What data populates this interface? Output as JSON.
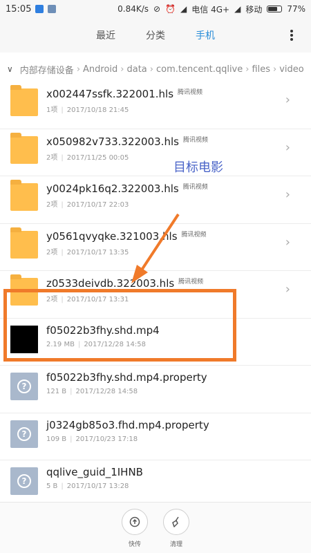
{
  "status_bar": {
    "time": "15:05",
    "speed": "0.84K/s",
    "carrier1": "电信 4G+",
    "carrier2": "移动",
    "battery_text": "77%",
    "battery_level": 0.77
  },
  "header": {
    "tabs": [
      {
        "label": "最近",
        "active": false
      },
      {
        "label": "分类",
        "active": false
      },
      {
        "label": "手机",
        "active": true
      }
    ]
  },
  "breadcrumb": {
    "parts": [
      "内部存储设备",
      "Android",
      "data",
      "com.tencent.qqlive",
      "files",
      "video"
    ]
  },
  "files": [
    {
      "name": "x002447ssfk.322001.hls",
      "tag": "腾讯视频",
      "size": "1项",
      "date": "2017/10/18 21:45",
      "type": "folder"
    },
    {
      "name": "x050982v733.322003.hls",
      "tag": "腾讯视频",
      "size": "2项",
      "date": "2017/11/25 00:05",
      "type": "folder"
    },
    {
      "name": "y0024pk16q2.322003.hls",
      "tag": "腾讯视频",
      "size": "2项",
      "date": "2017/10/17 22:03",
      "type": "folder"
    },
    {
      "name": "y0561qvyqke.321003.hls",
      "tag": "腾讯视频",
      "size": "2项",
      "date": "2017/10/17 13:35",
      "type": "folder"
    },
    {
      "name": "z0533deivdb.322003.hls",
      "tag": "腾讯视频",
      "size": "2项",
      "date": "2017/10/17 13:31",
      "type": "folder"
    },
    {
      "name": "f05022b3fhy.shd.mp4",
      "tag": "",
      "size": "2.19 MB",
      "date": "2017/12/28 14:58",
      "type": "video"
    },
    {
      "name": "f05022b3fhy.shd.mp4.property",
      "tag": "",
      "size": "121 B",
      "date": "2017/12/28 14:58",
      "type": "unknown"
    },
    {
      "name": "j0324gb85o3.fhd.mp4.property",
      "tag": "",
      "size": "109 B",
      "date": "2017/10/23 17:18",
      "type": "unknown"
    },
    {
      "name": "qqlive_guid_1IHNB",
      "tag": "",
      "size": "5 B",
      "date": "2017/10/17 13:28",
      "type": "unknown"
    }
  ],
  "annotation": {
    "text": "目标电影",
    "color": "#4a64c8",
    "box_color": "#f07a2a"
  },
  "bottom_bar": {
    "buttons": [
      {
        "label": "快传",
        "icon": "share-icon"
      },
      {
        "label": "清理",
        "icon": "broom-icon"
      }
    ]
  }
}
